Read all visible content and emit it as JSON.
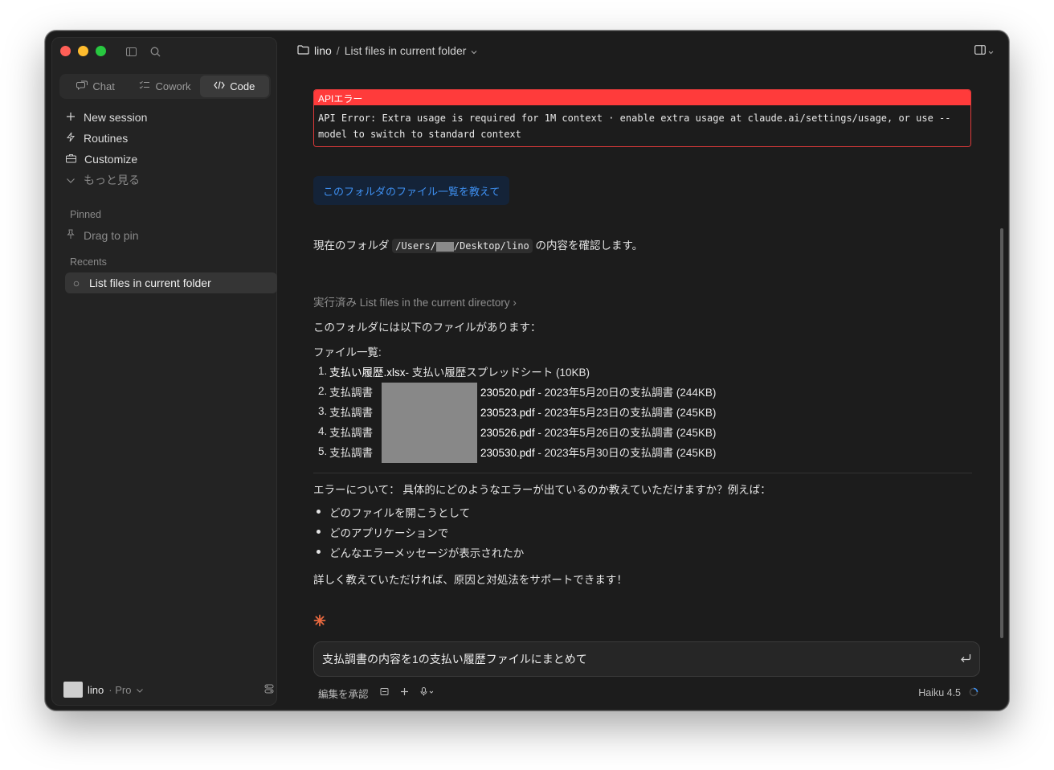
{
  "sidebar": {
    "mode_tabs": [
      {
        "label": "Chat",
        "icon": "chat-icon"
      },
      {
        "label": "Cowork",
        "icon": "checklist-icon"
      },
      {
        "label": "Code",
        "icon": "code-icon"
      }
    ],
    "nav": [
      {
        "label": "New session",
        "icon": "plus-icon"
      },
      {
        "label": "Routines",
        "icon": "bolt-icon"
      },
      {
        "label": "Customize",
        "icon": "briefcase-icon"
      },
      {
        "label": "もっと見る",
        "icon": "chevron-down-icon"
      }
    ],
    "pinned_label": "Pinned",
    "pinned_placeholder": "Drag to pin",
    "recents_label": "Recents",
    "recent_items": [
      "List files in current folder"
    ],
    "user": {
      "name": "lino",
      "plan": "· Pro"
    }
  },
  "topbar": {
    "folder": "lino",
    "separator": "/",
    "title": "List files in current folder"
  },
  "api_error": {
    "header": "APIエラー",
    "line1": "API Error: Extra usage is required for 1M context · enable extra usage at claude.ai/settings/usage, or use --",
    "line2": "model to switch to standard context"
  },
  "user_message": "このフォルダのファイル一覧を教えて",
  "response": {
    "intro_before": "現在のフォルダ",
    "path_prefix": "/Users/",
    "path_suffix": "/Desktop/lino",
    "intro_after": "の内容を確認します。",
    "tool_status": "実行済み List files in the current directory ›",
    "has_files": "このフォルダには以下のファイルがあります：",
    "list_heading": "ファイル一覧:",
    "files": [
      {
        "num": "1.",
        "prefix": "支払い履歴.xlsx",
        "desc": " - 支払い履歴スプレッドシート (10KB)"
      },
      {
        "num": "2.",
        "prefix": "支払調書",
        "name": "230520.pdf",
        "desc": " - 2023年5月20日の支払調書 (244KB)"
      },
      {
        "num": "3.",
        "prefix": "支払調書",
        "name": "230523.pdf",
        "desc": " - 2023年5月23日の支払調書 (245KB)"
      },
      {
        "num": "4.",
        "prefix": "支払調書",
        "name": "230526.pdf",
        "desc": " - 2023年5月26日の支払調書 (245KB)"
      },
      {
        "num": "5.",
        "prefix": "支払調書",
        "name": "230530.pdf",
        "desc": " - 2023年5月30日の支払調書 (245KB)"
      }
    ],
    "error_question": "エラーについて： 具体的にどのようなエラーが出ているのか教えていただけますか？例えば：",
    "bullets": [
      "どのファイルを開こうとして",
      "どのアプリケーションで",
      "どんなエラーメッセージが表示されたか"
    ],
    "closing": "詳しく教えていただければ、原因と対処法をサポートできます！"
  },
  "composer": {
    "text": "支払調書の内容を1の支払い履歴ファイルにまとめて",
    "approve_label": "編集を承認",
    "model": "Haiku 4.5"
  },
  "colors": {
    "accent": "#3e8ff0",
    "error": "#ff3b3b",
    "spark": "#e8693f"
  }
}
